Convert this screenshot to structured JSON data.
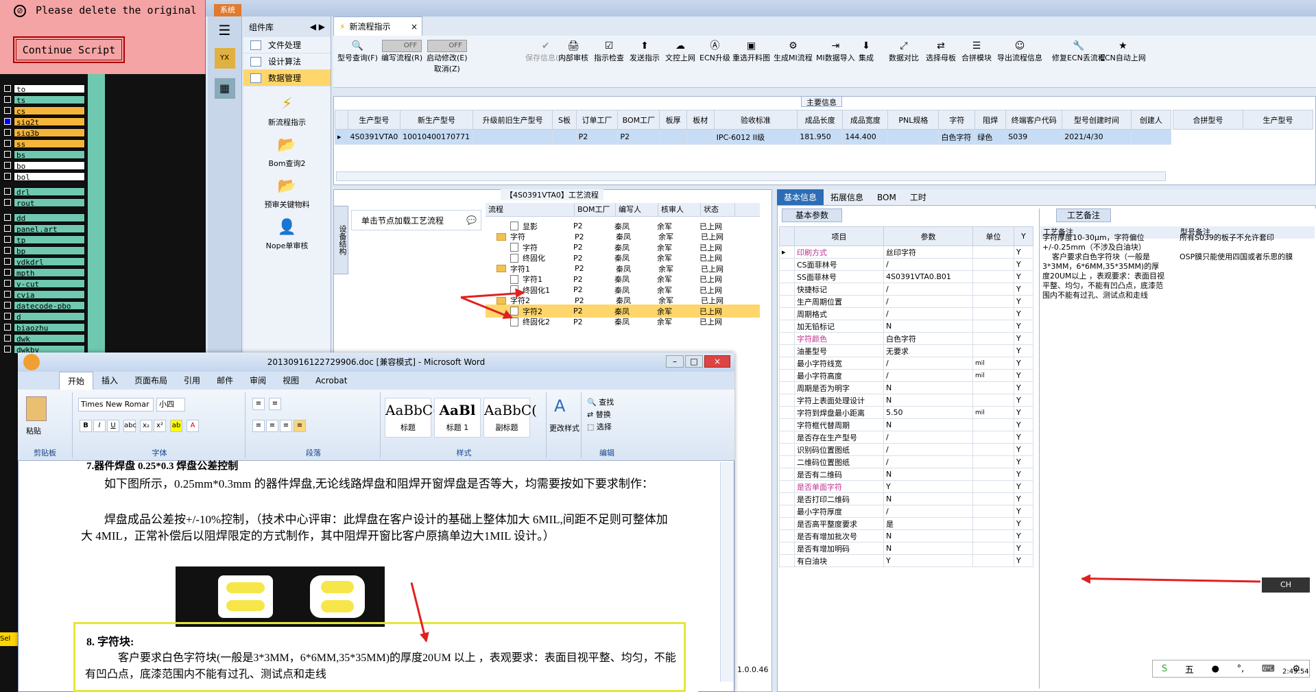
{
  "cam": {
    "alert_text": "Please delete the original",
    "continue_label": "Continue Script",
    "layers": [
      "to",
      "ts",
      "cs",
      "sig2t",
      "sig3b",
      "ss",
      "bs",
      "bo",
      "bol",
      "drl",
      "rout",
      "dd",
      "panel.art",
      "tp",
      "bp",
      "ydkdrl",
      "mpth",
      "v-cut",
      "cvia",
      "datecode-pbo",
      "d",
      "biaozhu",
      "dwk",
      "dwkby"
    ],
    "sel_label": "Sel"
  },
  "app": {
    "sys_tab": "系统",
    "comp_lib": "组件库",
    "nav": [
      "文件处理",
      "设计算法",
      "数据管理"
    ],
    "tools": [
      "新流程指示",
      "Bom查询2",
      "预审关键物料",
      "Nope单审核"
    ],
    "doc_tab": "新流程指示",
    "toolbar": [
      "型号查询(F)",
      "编写流程(R)",
      "启动修改(E)",
      "保存信息(S)",
      "内部审核",
      "指示检查",
      "发送指示",
      "文控上网",
      "ECN升级",
      "重选开料图",
      "生成MI流程",
      "MI数据导入",
      "集成",
      "数据对比",
      "选择母板",
      "合拼模块",
      "导出流程信息",
      "修复ECN丢流程",
      "ECN自动上网"
    ],
    "toggle_off": "OFF",
    "cancel_label": "取消(Z)",
    "main_info_title": "主要信息",
    "main_cols": [
      "生产型号",
      "新生产型号",
      "升级前旧生产型号",
      "S板",
      "订单工厂",
      "BOM工厂",
      "板厚",
      "板材",
      "验收标准",
      "成品长度",
      "成品宽度",
      "PNL规格",
      "字符",
      "阻焊",
      "终端客户代码",
      "型号创建时间",
      "创建人"
    ],
    "main_row": [
      "4S0391VTA0",
      "10010400170771",
      "",
      "",
      "P2",
      "P2",
      "",
      "",
      "IPC-6012 II级",
      "181.950",
      "144.400",
      "",
      "白色字符",
      "绿色",
      "S039",
      "2021/4/30",
      ""
    ],
    "merge_cols": [
      "合拼型号",
      "生产型号"
    ],
    "process_title": "【4S0391VTA0】工艺流程",
    "vtab": "设备结构",
    "hint": "单击节点加载工艺流程",
    "tree_cols": [
      "流程",
      "BOM工厂",
      "编写人",
      "核审人",
      "状态"
    ],
    "tree": [
      {
        "name": "显影",
        "f": "P2",
        "w": "秦凤",
        "r": "余军",
        "s": "已上网",
        "lvl": 2,
        "type": "file"
      },
      {
        "name": "字符",
        "f": "P2",
        "w": "秦凤",
        "r": "余军",
        "s": "已上网",
        "lvl": 1,
        "type": "folder"
      },
      {
        "name": "字符",
        "f": "P2",
        "w": "秦凤",
        "r": "余军",
        "s": "已上网",
        "lvl": 2,
        "type": "file"
      },
      {
        "name": "终固化",
        "f": "P2",
        "w": "秦凤",
        "r": "余军",
        "s": "已上网",
        "lvl": 2,
        "type": "file"
      },
      {
        "name": "字符1",
        "f": "P2",
        "w": "秦凤",
        "r": "余军",
        "s": "已上网",
        "lvl": 1,
        "type": "folder"
      },
      {
        "name": "字符1",
        "f": "P2",
        "w": "秦凤",
        "r": "余军",
        "s": "已上网",
        "lvl": 2,
        "type": "file"
      },
      {
        "name": "终固化1",
        "f": "P2",
        "w": "秦凤",
        "r": "余军",
        "s": "已上网",
        "lvl": 2,
        "type": "file"
      },
      {
        "name": "字符2",
        "f": "P2",
        "w": "秦凤",
        "r": "余军",
        "s": "已上网",
        "lvl": 1,
        "type": "folder"
      },
      {
        "name": "字符2",
        "f": "P2",
        "w": "秦凤",
        "r": "余军",
        "s": "已上网",
        "lvl": 2,
        "type": "file",
        "hl": true
      },
      {
        "name": "终固化2",
        "f": "P2",
        "w": "秦凤",
        "r": "余军",
        "s": "已上网",
        "lvl": 2,
        "type": "file"
      }
    ],
    "right_tabs": [
      "基本信息",
      "拓展信息",
      "BOM",
      "工时"
    ],
    "basic_tab": "基本参数",
    "param_cols": [
      "项目",
      "参数",
      "单位",
      "Y"
    ],
    "params": [
      {
        "k": "印刷方式",
        "v": "丝印字符",
        "u": "",
        "c": "#c03090"
      },
      {
        "k": "CS面菲林号",
        "v": "/",
        "u": ""
      },
      {
        "k": "SS面菲林号",
        "v": "4S0391VTA0.B01",
        "u": ""
      },
      {
        "k": "快捷标记",
        "v": "/",
        "u": ""
      },
      {
        "k": "生产周期位置",
        "v": "/",
        "u": ""
      },
      {
        "k": "周期格式",
        "v": "/",
        "u": ""
      },
      {
        "k": "加无铅标记",
        "v": "N",
        "u": ""
      },
      {
        "k": "字符颜色",
        "v": "白色字符",
        "u": "",
        "c": "#c03090"
      },
      {
        "k": "油墨型号",
        "v": "无要求",
        "u": ""
      },
      {
        "k": "最小字符线宽",
        "v": "/",
        "u": "mil"
      },
      {
        "k": "最小字符高度",
        "v": "/",
        "u": "mil"
      },
      {
        "k": "周期是否为明字",
        "v": "N",
        "u": ""
      },
      {
        "k": "字符上表面处理设计",
        "v": "N",
        "u": ""
      },
      {
        "k": "字符到焊盘最小距离",
        "v": "5.50",
        "u": "mil"
      },
      {
        "k": "字符框代替周期",
        "v": "N",
        "u": ""
      },
      {
        "k": "是否存在生产型号",
        "v": "/",
        "u": ""
      },
      {
        "k": "识别码位置图纸",
        "v": "/",
        "u": ""
      },
      {
        "k": "二维码位置图纸",
        "v": "/",
        "u": ""
      },
      {
        "k": "是否有二维码",
        "v": "N",
        "u": ""
      },
      {
        "k": "是否单面字符",
        "v": "Y",
        "u": "",
        "c": "#c03090"
      },
      {
        "k": "是否打印二维码",
        "v": "N",
        "u": ""
      },
      {
        "k": "最小字符厚度",
        "v": "/",
        "u": ""
      },
      {
        "k": "是否高平整度要求",
        "v": "是",
        "u": ""
      },
      {
        "k": "是否有增加批次号",
        "v": "N",
        "u": ""
      },
      {
        "k": "是否有增加明码",
        "v": "N",
        "u": ""
      },
      {
        "k": "有白油块",
        "v": "Y",
        "u": ""
      }
    ],
    "note_tab": "工艺备注",
    "note_col1": "工艺备注",
    "note_col2": "型号备注",
    "note_text": "字符厚度10-30μm，字符偏位+/-0.25mm（不涉及白油块）\n    客户要求白色字符块（一般是3*3MM，6*6MM,35*35MM)的厚度20UM以上 ，表观要求：表面目视平整、均匀，不能有凹凸点，底漆范围内不能有过孔、测试点和走线",
    "model_note": "所有S039的板子不允许套印\n\nOSP膜只能使用四国或者乐思的膜",
    "status_ver": "1.0.0.46",
    "time": "2:49:54",
    "ime": "CH",
    "tray_ime": "五"
  },
  "word": {
    "title": "20130916122729906.doc [兼容模式] - Microsoft Word",
    "tabs": [
      "开始",
      "插入",
      "页面布局",
      "引用",
      "邮件",
      "审阅",
      "视图",
      "Acrobat"
    ],
    "font": "Times New Romar",
    "size": "小四",
    "groups": [
      "剪贴板",
      "字体",
      "段落",
      "样式",
      "编辑"
    ],
    "paste": "粘贴",
    "styles": [
      {
        "p": "AaBbC(",
        "n": "标题"
      },
      {
        "p": "AaBl",
        "n": "标题 1"
      },
      {
        "p": "AaBbC(",
        "n": "副标题"
      }
    ],
    "change_style": "更改样式",
    "find": "查找",
    "replace": "替换",
    "select": "选择",
    "heading7": "7.器件焊盘 0.25*0.3 焊盘公差控制",
    "p1": "如下图所示，0.25mm*0.3mm 的器件焊盘,无论线路焊盘和阻焊开窗焊盘是否等大，均需要按如下要求制作：",
    "p2": "焊盘成品公差按+/-10%控制，（技术中心评审：此焊盘在客户设计的基础上整体加大 6MIL,间距不足则可整体加大 4MIL，正常补偿后以阻焊限定的方式制作，其中阻焊开窗比客户原搞单边大1MIL 设计。）",
    "heading8": "8. 字符块:",
    "p3": "客户要求白色字符块(一般是3*3MM，6*6MM,35*35MM)的厚度20UM 以上 ，表观要求：表面目视平整、均匀，不能有凹凸点，底漆范围内不能有过孔、测试点和走线"
  }
}
